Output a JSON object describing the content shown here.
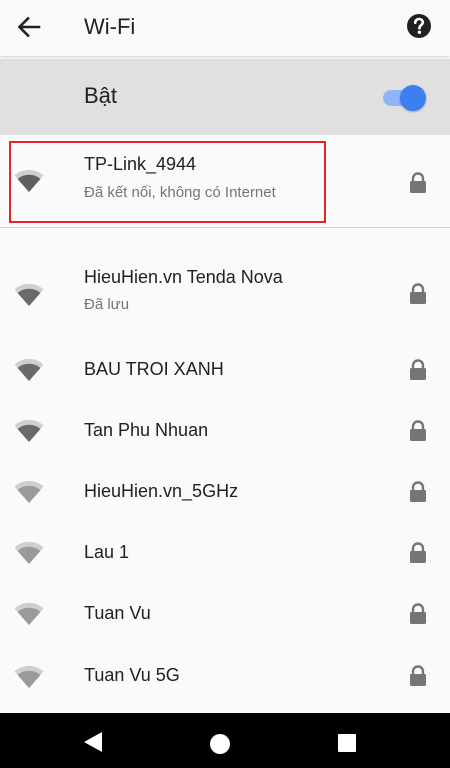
{
  "header": {
    "title": "Wi-Fi",
    "back_icon": "arrow-left-icon",
    "help_icon": "help-circle-icon"
  },
  "master_switch": {
    "label": "Bật",
    "state": "on",
    "accent_color": "#3b7ff0"
  },
  "connected_network": {
    "name": "TP-Link_4944",
    "status": "Đã kết nối, không có Internet",
    "secured": true,
    "highlight_color": "#e3262d"
  },
  "networks": [
    {
      "name": "HieuHien.vn Tenda Nova",
      "status": "Đã lưu",
      "secured": true
    },
    {
      "name": "BAU TROI XANH",
      "status": "",
      "secured": true
    },
    {
      "name": "Tan Phu Nhuan",
      "status": "",
      "secured": true
    },
    {
      "name": "HieuHien.vn_5GHz",
      "status": "",
      "secured": true
    },
    {
      "name": "Lau 1",
      "status": "",
      "secured": true
    },
    {
      "name": "Tuan Vu",
      "status": "",
      "secured": true
    },
    {
      "name": "Tuan Vu 5G",
      "status": "",
      "secured": true
    }
  ],
  "nav_bar": {
    "back_icon": "triangle-back-icon",
    "home_icon": "circle-home-icon",
    "recents_icon": "square-recents-icon"
  }
}
